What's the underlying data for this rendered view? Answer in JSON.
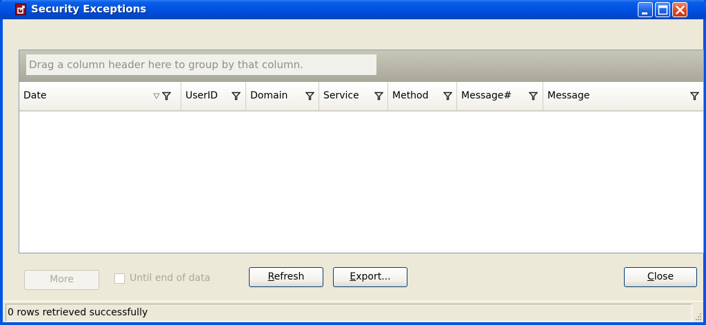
{
  "window": {
    "title": "Security Exceptions"
  },
  "grid": {
    "group_hint": "Drag a column header here to group by that column.",
    "columns": [
      {
        "label": "Date"
      },
      {
        "label": "UserID"
      },
      {
        "label": "Domain"
      },
      {
        "label": "Service"
      },
      {
        "label": "Method"
      },
      {
        "label": "Message#"
      },
      {
        "label": "Message"
      }
    ],
    "rows": []
  },
  "controls": {
    "more_label": "More",
    "until_end_label": "Until end of data",
    "until_end_checked": false,
    "refresh_label": "Refresh",
    "export_label": "Export...",
    "close_label": "Close"
  },
  "status": {
    "text": "0 rows retrieved successfully"
  },
  "colors": {
    "titlebar": "#0054e3",
    "frame": "#0055e5",
    "face": "#ece9d8",
    "close_button": "#e0461f"
  }
}
